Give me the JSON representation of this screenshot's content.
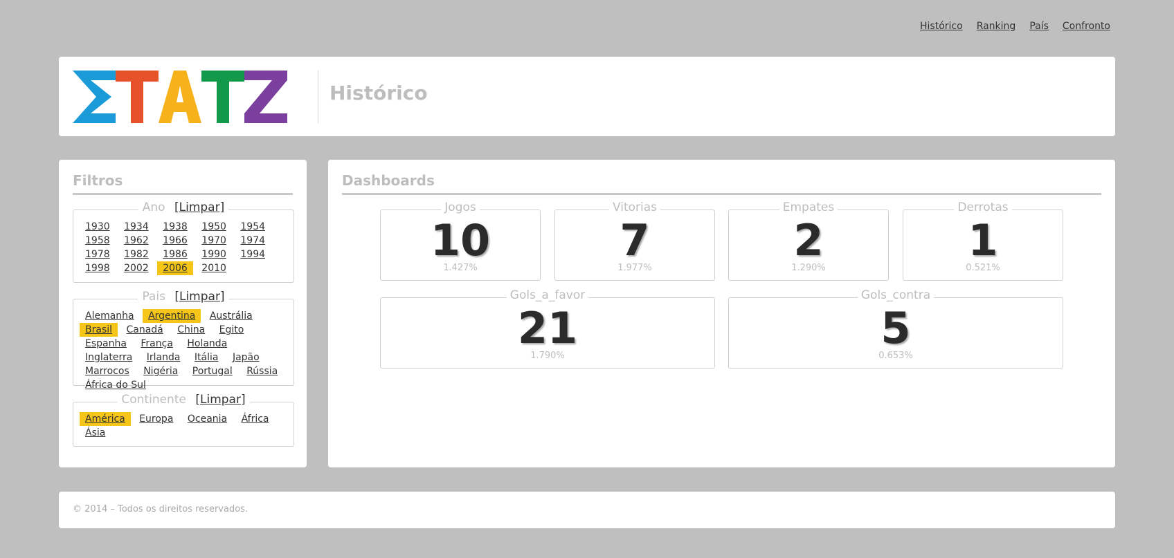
{
  "nav": {
    "items": [
      "Histórico",
      "Ranking",
      "País",
      "Confronto"
    ]
  },
  "header": {
    "logo_text": "STATZ",
    "page_title": "Histórico"
  },
  "logo_colors": [
    "#1a9bd7",
    "#e8522b",
    "#f6b21a",
    "#129a4a",
    "#7b3f9d"
  ],
  "filters": {
    "title": "Filtros",
    "clear_label": "[Limpar]",
    "ano": {
      "label": "Ano",
      "items": [
        "1930",
        "1934",
        "1938",
        "1950",
        "1954",
        "1958",
        "1962",
        "1966",
        "1970",
        "1974",
        "1978",
        "1982",
        "1986",
        "1990",
        "1994",
        "1998",
        "2002",
        "2006",
        "2010"
      ],
      "selected": [
        "2006"
      ]
    },
    "pais": {
      "label": "Pais",
      "items": [
        "Alemanha",
        "Argentina",
        "Austrália",
        "Brasil",
        "Canadá",
        "China",
        "Egito",
        "Espanha",
        "França",
        "Holanda",
        "Inglaterra",
        "Irlanda",
        "Itália",
        "Japão",
        "Marrocos",
        "Nigéria",
        "Portugal",
        "Rússia",
        "África do Sul"
      ],
      "selected": [
        "Argentina",
        "Brasil"
      ]
    },
    "continente": {
      "label": "Continente",
      "items": [
        "América",
        "Europa",
        "Oceania",
        "África",
        "Ásia"
      ],
      "selected": [
        "América"
      ]
    }
  },
  "dashboards": {
    "title": "Dashboards",
    "cards": {
      "jogos": {
        "label": "Jogos",
        "value": "10",
        "pct": "1.427%"
      },
      "vitorias": {
        "label": "Vitorias",
        "value": "7",
        "pct": "1.977%"
      },
      "empates": {
        "label": "Empates",
        "value": "2",
        "pct": "1.290%"
      },
      "derrotas": {
        "label": "Derrotas",
        "value": "1",
        "pct": "0.521%"
      },
      "gols_a_favor": {
        "label": "Gols_a_favor",
        "value": "21",
        "pct": "1.790%"
      },
      "gols_contra": {
        "label": "Gols_contra",
        "value": "5",
        "pct": "0.653%"
      }
    }
  },
  "footer": {
    "text": "© 2014 – Todos os direitos reservados."
  },
  "colors": {
    "background": "#bfbfbf",
    "highlight": "#f5c518",
    "muted_title": "#bdbdbd"
  }
}
